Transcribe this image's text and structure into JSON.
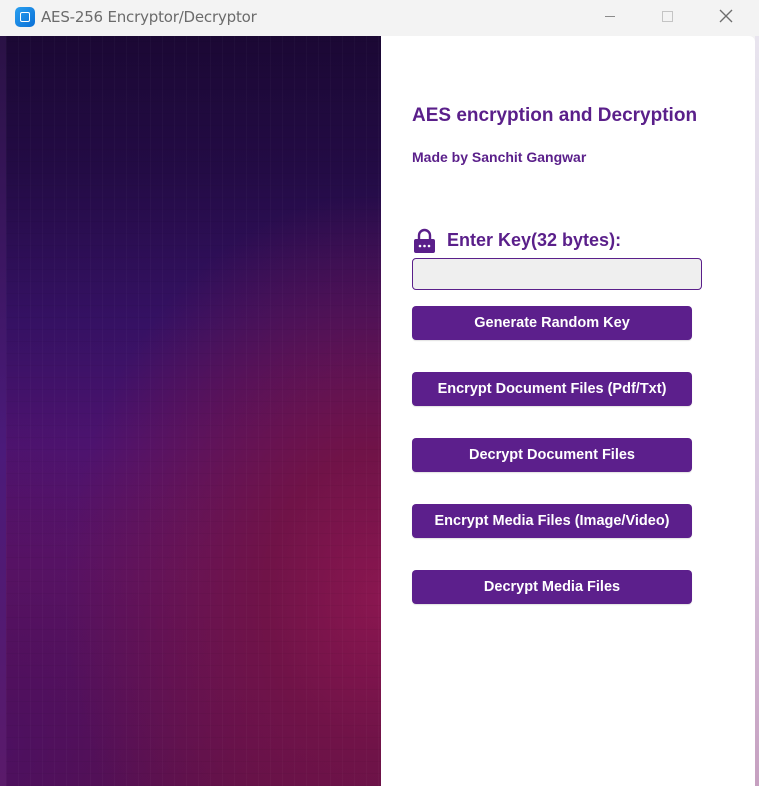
{
  "window": {
    "title": "AES-256 Encryptor/Decryptor",
    "app_icon": "app-window-icon",
    "controls": {
      "minimize_icon": "minimize-icon",
      "maximize_icon": "maximize-icon",
      "close_icon": "close-icon"
    }
  },
  "main": {
    "heading": "AES encryption and Decryption",
    "author": "Made by Sanchit Gangwar",
    "key_label": "Enter Key(32 bytes):",
    "key_icon": "lock-icon",
    "key_value": "",
    "buttons": [
      "Generate Random Key",
      "Encrypt Document Files (Pdf/Txt)",
      "Decrypt Document Files",
      "Encrypt Media Files (Image/Video)",
      "Decrypt Media Files"
    ]
  },
  "colors": {
    "accent": "#5c1f8c",
    "heading_text": "#5a1f8a",
    "input_background": "#efefef",
    "panel_background": "#ffffff",
    "gradient_top": "#1b0834",
    "gradient_bottom": "#8a1650"
  }
}
